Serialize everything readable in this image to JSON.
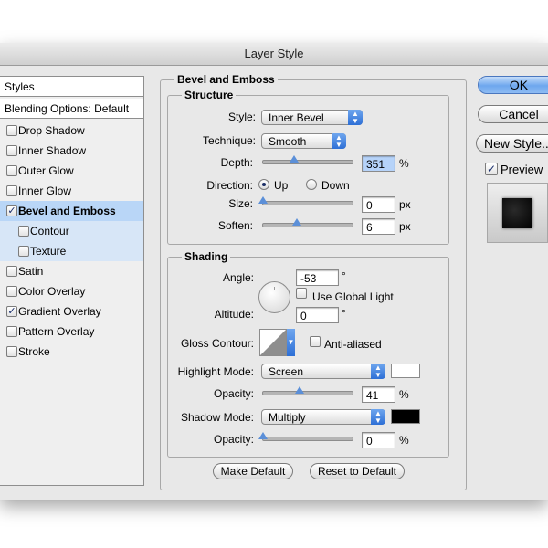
{
  "window": {
    "title": "Layer Style"
  },
  "styles_panel": {
    "header": "Styles",
    "blending": "Blending Options: Default",
    "items": [
      {
        "label": "Drop Shadow",
        "checked": false
      },
      {
        "label": "Inner Shadow",
        "checked": false
      },
      {
        "label": "Outer Glow",
        "checked": false
      },
      {
        "label": "Inner Glow",
        "checked": false
      },
      {
        "label": "Bevel and Emboss",
        "checked": true,
        "selected": true
      },
      {
        "label": "Contour",
        "checked": false,
        "sub": true
      },
      {
        "label": "Texture",
        "checked": false,
        "sub": true
      },
      {
        "label": "Satin",
        "checked": false
      },
      {
        "label": "Color Overlay",
        "checked": false
      },
      {
        "label": "Gradient Overlay",
        "checked": true
      },
      {
        "label": "Pattern Overlay",
        "checked": false
      },
      {
        "label": "Stroke",
        "checked": false
      }
    ]
  },
  "bevel": {
    "section_title": "Bevel and Emboss",
    "structure": {
      "title": "Structure",
      "style_label": "Style:",
      "style_value": "Inner Bevel",
      "technique_label": "Technique:",
      "technique_value": "Smooth",
      "depth_label": "Depth:",
      "depth_value": "351",
      "depth_unit": "%",
      "depth_slider": 0.35,
      "direction_label": "Direction:",
      "direction_up": "Up",
      "direction_down": "Down",
      "direction_selected": "Up",
      "size_label": "Size:",
      "size_value": "0",
      "size_unit": "px",
      "size_slider": 0.0,
      "soften_label": "Soften:",
      "soften_value": "6",
      "soften_unit": "px",
      "soften_slider": 0.38
    },
    "shading": {
      "title": "Shading",
      "angle_label": "Angle:",
      "angle_value": "-53",
      "angle_unit": "°",
      "global_light_label": "Use Global Light",
      "global_light_checked": false,
      "altitude_label": "Altitude:",
      "altitude_value": "0",
      "altitude_unit": "°",
      "gloss_label": "Gloss Contour:",
      "anti_aliased_label": "Anti-aliased",
      "anti_aliased_checked": false,
      "highlight_mode_label": "Highlight Mode:",
      "highlight_mode_value": "Screen",
      "highlight_color": "#ffffff",
      "highlight_opacity_label": "Opacity:",
      "highlight_opacity_value": "41",
      "highlight_opacity_unit": "%",
      "highlight_opacity_slider": 0.41,
      "shadow_mode_label": "Shadow Mode:",
      "shadow_mode_value": "Multiply",
      "shadow_color": "#000000",
      "shadow_opacity_label": "Opacity:",
      "shadow_opacity_value": "0",
      "shadow_opacity_unit": "%",
      "shadow_opacity_slider": 0.0
    }
  },
  "footer": {
    "make_default": "Make Default",
    "reset_default": "Reset to Default"
  },
  "actions": {
    "ok": "OK",
    "cancel": "Cancel",
    "new_style": "New Style...",
    "preview_label": "Preview",
    "preview_checked": true
  }
}
